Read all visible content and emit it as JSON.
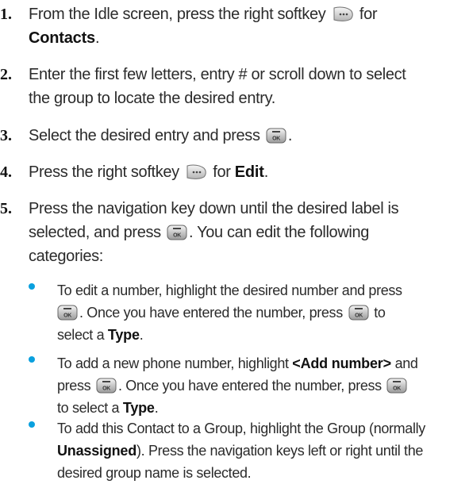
{
  "steps": [
    {
      "number": "1.",
      "line1_prefix": "From the Idle screen, press the right softkey",
      "line1_suffix": "for",
      "bold": "Contacts",
      "suffix": "."
    },
    {
      "number": "2.",
      "line1": "Enter the first few letters, entry # or scroll down to select",
      "line2": "the group to locate the desired entry."
    },
    {
      "number": "3.",
      "prefix": "Select the desired entry and press",
      "suffix": "."
    },
    {
      "number": "4.",
      "prefix": "Press the right softkey",
      "middle": "for",
      "bold": "Edit",
      "suffix": "."
    },
    {
      "number": "5.",
      "line1": "Press the navigation key down until the desired label is",
      "line2_prefix": "selected, and press",
      "line2_suffix": ". You can edit the following",
      "line3": "categories:"
    }
  ],
  "bullets": [
    {
      "line1": "To edit a number, highlight the desired number and press",
      "line2_mid": ". Once you have entered the number, press",
      "line2_tail": "to",
      "line3_prefix": "select a",
      "line3_bold": "Type",
      "line3_suffix": "."
    },
    {
      "line1_prefix": "To add a new phone number, highlight",
      "line1_bold": "<Add number>",
      "line1_suffix": "and",
      "line2_prefix": "press",
      "line2_mid": ". Once you have entered the number, press",
      "line3_prefix": "to select a",
      "line3_bold": "Type",
      "line3_suffix": "."
    },
    {
      "line1": "To add this Contact to a Group, highlight the Group (normally",
      "line2_bold": "Unassigned",
      "line2_suffix": "). Press the navigation keys left or right until the",
      "line3": "desired group name is selected."
    }
  ],
  "colors": {
    "bullet": "#0aa0de",
    "text": "#2b2b2b",
    "number": "#111111"
  },
  "icons": {
    "softkey": "right-softkey-icon",
    "ok_key": "menu-ok-key-icon"
  }
}
